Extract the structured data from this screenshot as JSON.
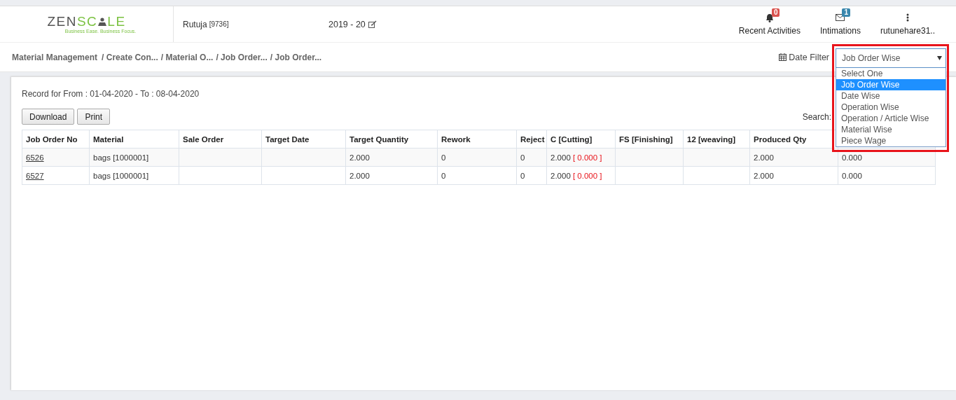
{
  "header": {
    "logo": {
      "text_dark": "ZEN",
      "text_accent_before": "SC",
      "text_accent_after": "LE",
      "tagline": "Business Ease. Business Focus."
    },
    "user": {
      "name": "Rutuja",
      "code": "[9736]"
    },
    "year": "2019 - 20",
    "actions": [
      {
        "kind": "bell",
        "label": "Recent Activities",
        "count": "0",
        "color": "#d9534f"
      },
      {
        "kind": "envelope",
        "label": "Intimations",
        "count": "1",
        "color": "#3a87ad"
      },
      {
        "kind": "menu",
        "label": "rutunehare31.."
      }
    ]
  },
  "breadcrumb": [
    "Material Management",
    "/ Create Con...",
    "/ Material O...",
    "/ Job Order...",
    "/ Job Order..."
  ],
  "date_filter": {
    "label": "Date Filter",
    "value": "Job Order Wise",
    "expanded": true,
    "options": [
      {
        "label": "Select One",
        "selected": false
      },
      {
        "label": "Job Order Wise",
        "selected": true
      },
      {
        "label": "Date Wise",
        "selected": false
      },
      {
        "label": "Operation Wise",
        "selected": false
      },
      {
        "label": "Operation / Article Wise",
        "selected": false
      },
      {
        "label": "Material Wise",
        "selected": false
      },
      {
        "label": "Piece Wage",
        "selected": false
      }
    ]
  },
  "report": {
    "record_text": "Record for From : 01-04-2020 - To : 08-04-2020",
    "buttons": [
      "Download",
      "Print"
    ],
    "search_label": "Search:",
    "table": {
      "columns": [
        {
          "label": "Job Order No",
          "kind": "link"
        },
        {
          "label": "Material",
          "kind": "text"
        },
        {
          "label": "Sale Order",
          "kind": "text"
        },
        {
          "label": "Target Date",
          "kind": "text"
        },
        {
          "label": "Target Quantity",
          "kind": "text"
        },
        {
          "label": "Rework",
          "kind": "text"
        },
        {
          "label": "Reject",
          "kind": "text"
        },
        {
          "label": "C [Cutting]",
          "kind": "operation"
        },
        {
          "label": "FS [Finishing]",
          "kind": "operation"
        },
        {
          "label": "12 [weaving]",
          "kind": "operation"
        },
        {
          "label": "Produced Qty",
          "kind": "text"
        },
        {
          "kind": "text"
        }
      ],
      "rows": [
        [
          {
            "text": "6526"
          },
          {
            "text": "bags [1000001]"
          },
          {},
          {},
          {
            "text": "2.000"
          },
          {
            "text": "0"
          },
          {
            "text": "0"
          },
          {
            "text": "2.000",
            "reject": "[ 0.000 ]"
          },
          {},
          {},
          {
            "text": "2.000"
          },
          {
            "text": "0.000"
          }
        ],
        [
          {
            "text": "6527"
          },
          {
            "text": "bags [1000001]"
          },
          {},
          {},
          {
            "text": "2.000"
          },
          {
            "text": "0"
          },
          {
            "text": "0"
          },
          {
            "text": "2.000",
            "reject": "[ 0.000 ]"
          },
          {},
          {},
          {
            "text": "2.000"
          },
          {
            "text": "0.000"
          }
        ]
      ]
    }
  }
}
